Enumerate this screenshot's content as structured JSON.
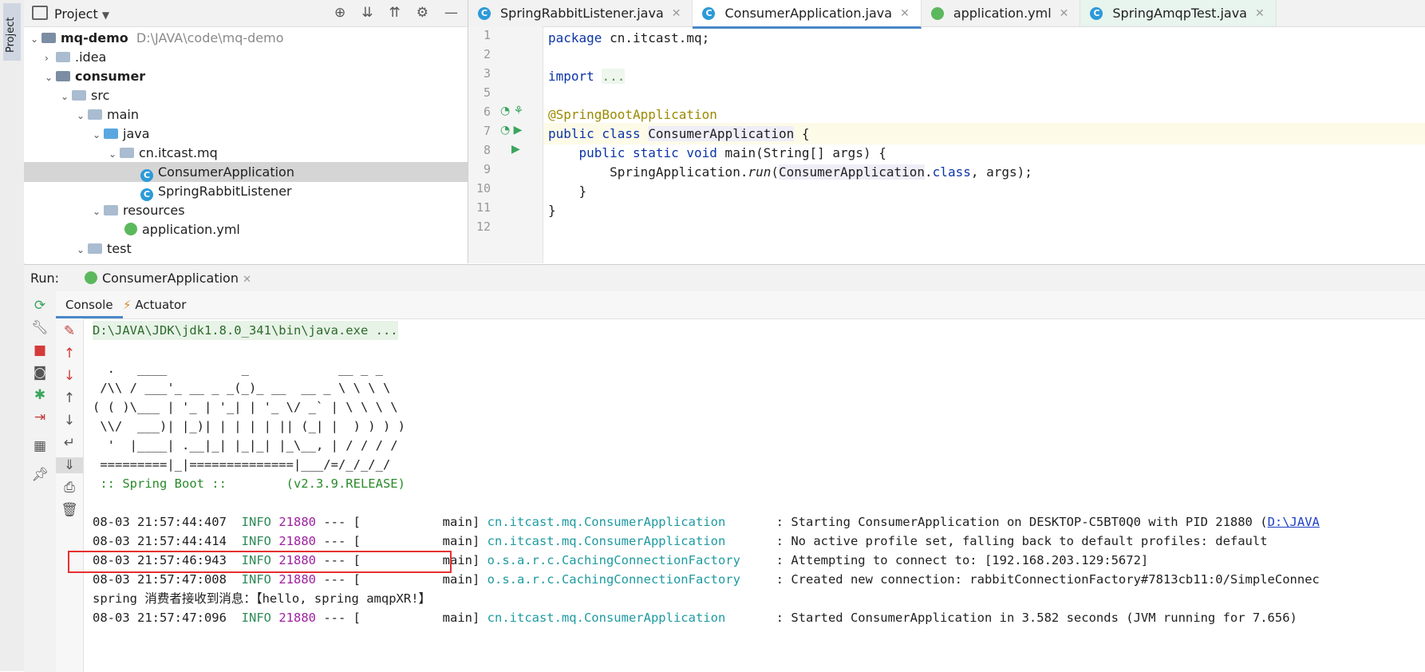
{
  "toolstrip": {
    "project_tab": "Project"
  },
  "project_panel": {
    "title": "Project",
    "tree": [
      {
        "label": "mq-demo",
        "extra": "D:\\JAVA\\code\\mq-demo"
      },
      {
        "label": ".idea"
      },
      {
        "label": "consumer"
      },
      {
        "label": "src"
      },
      {
        "label": "main"
      },
      {
        "label": "java"
      },
      {
        "label": "cn.itcast.mq"
      },
      {
        "label": "ConsumerApplication"
      },
      {
        "label": "SpringRabbitListener"
      },
      {
        "label": "resources"
      },
      {
        "label": "application.yml"
      },
      {
        "label": "test"
      }
    ]
  },
  "editor": {
    "tabs": [
      {
        "label": "SpringRabbitListener.java",
        "active": false
      },
      {
        "label": "ConsumerApplication.java",
        "active": true
      },
      {
        "label": "application.yml",
        "active": false
      },
      {
        "label": "SpringAmqpTest.java",
        "active": false
      }
    ],
    "line_numbers": [
      "1",
      "2",
      "3",
      "5",
      "6",
      "7",
      "8",
      "9",
      "10",
      "11",
      "12"
    ]
  },
  "run_panel": {
    "label": "Run:",
    "config": "ConsumerApplication",
    "subtabs": [
      "Console",
      "Actuator"
    ],
    "console": {
      "java_cmd": "D:\\JAVA\\JDK\\jdk1.8.0_341\\bin\\java.exe ...",
      "banner": [
        "  .   ____          _            __ _ _",
        " /\\\\ / ___'_ __ _ _(_)_ __  __ _ \\ \\ \\ \\",
        "( ( )\\___ | '_ | '_| | '_ \\/ _` | \\ \\ \\ \\",
        " \\\\/  ___)| |_)| | | | | || (_| |  ) ) ) )",
        "  '  |____| .__|_| |_|_| |_\\__, | / / / /",
        " =========|_|==============|___/=/_/_/_/"
      ],
      "spring_boot": " :: Spring Boot ::        (v2.3.9.RELEASE)",
      "logs": [
        {
          "time": "08-03 21:57:44:407",
          "level": "INFO",
          "pid": "21880",
          "thread": "--- [           main]",
          "logger": "cn.itcast.mq.ConsumerApplication",
          "msg": ": Starting ConsumerApplication on DESKTOP-C5BT0Q0 with PID 21880 (",
          "link": "D:\\JAVA"
        },
        {
          "time": "08-03 21:57:44:414",
          "level": "INFO",
          "pid": "21880",
          "thread": "--- [           main]",
          "logger": "cn.itcast.mq.ConsumerApplication",
          "msg": ": No active profile set, falling back to default profiles: default"
        },
        {
          "time": "08-03 21:57:46:943",
          "level": "INFO",
          "pid": "21880",
          "thread": "--- [           main]",
          "logger": "o.s.a.r.c.CachingConnectionFactory",
          "msg": ": Attempting to connect to: [192.168.203.129:5672]"
        },
        {
          "time": "08-03 21:57:47:008",
          "level": "INFO",
          "pid": "21880",
          "thread": "--- [           main]",
          "logger": "o.s.a.r.c.CachingConnectionFactory",
          "msg": ": Created new connection: rabbitConnectionFactory#7813cb11:0/SimpleConnec"
        }
      ],
      "received": "spring 消费者接收到消息：【hello, spring amqpXR!】",
      "last_log": {
        "time": "08-03 21:57:47:096",
        "level": "INFO",
        "pid": "21880",
        "thread": "--- [           main]",
        "logger": "cn.itcast.mq.ConsumerApplication",
        "msg": ": Started ConsumerApplication in 3.582 seconds (JVM running for 7.656)"
      }
    }
  },
  "colors": {
    "accent": "#4a88c7",
    "highlight_border": "#e53030"
  }
}
